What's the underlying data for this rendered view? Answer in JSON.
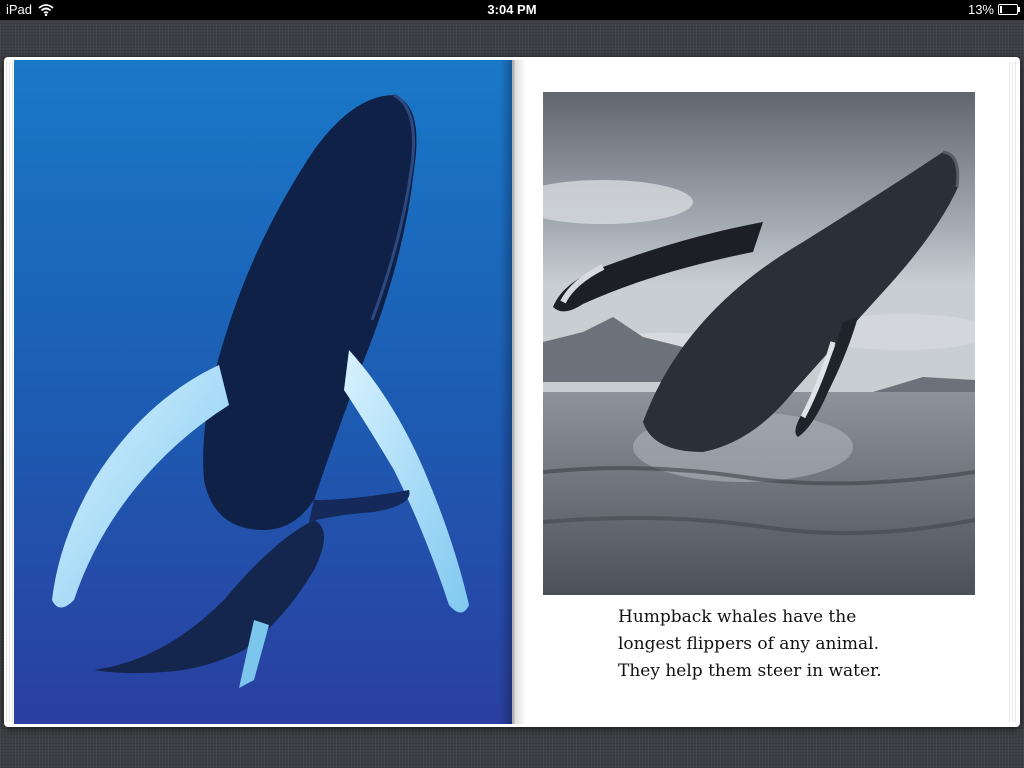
{
  "status_bar": {
    "device": "iPad",
    "time": "3:04 PM",
    "battery_percent": "13%",
    "battery_level": 0.13
  },
  "icons": [
    "wifi-icon",
    "battery-icon"
  ],
  "book": {
    "left_page": {
      "image": "humpback-whale-underwater-photo"
    },
    "right_page": {
      "image": "humpback-whale-breaching-photo",
      "caption": [
        "Humpback whales have the",
        "longest flippers of any animal.",
        "They help them steer in water."
      ]
    }
  },
  "colors": {
    "ocean_blue": "#1d5fb0",
    "page_white": "#ffffff",
    "linen": "#3d3f44"
  }
}
